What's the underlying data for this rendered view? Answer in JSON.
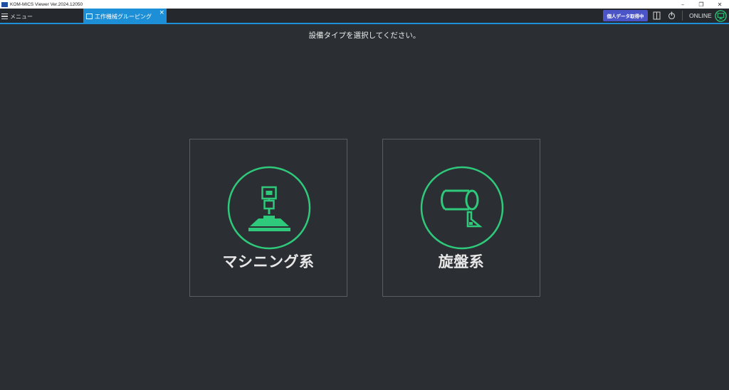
{
  "window": {
    "title": "KOM-MICS Viewer  Ver.2024.12050",
    "minimize": "–",
    "restore": "❐",
    "close": "✕"
  },
  "tabbar": {
    "menu_label": "メニュー",
    "active_tab_label": "工作機械グルーピング",
    "active_tab_close": "×",
    "personal_data_button": "個人データ取得中",
    "status_label": "ONLINE"
  },
  "main": {
    "instruction": "設備タイプを選択してください。",
    "options": [
      {
        "label": "マシニング系",
        "icon": "machining-icon"
      },
      {
        "label": "旋盤系",
        "icon": "lathe-icon"
      }
    ]
  },
  "colors": {
    "background": "#2b2f33",
    "accent_blue": "#1c8fd6",
    "icon_green": "#2ec97a",
    "button_purple": "#4b55c7"
  }
}
